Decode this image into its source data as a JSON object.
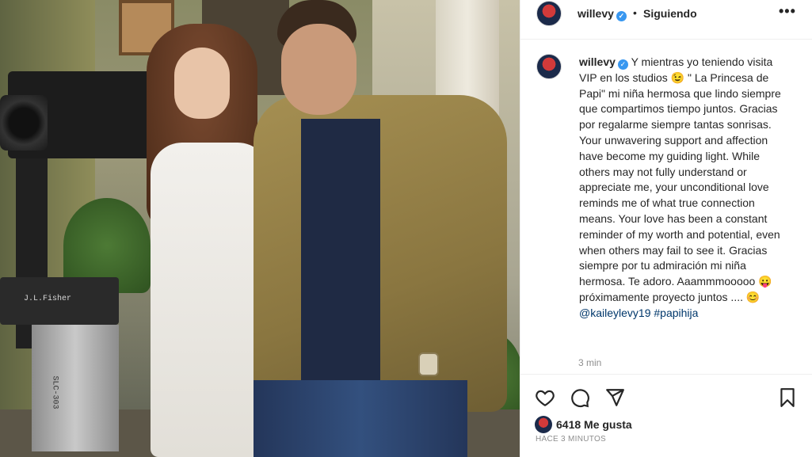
{
  "header": {
    "username": "willevy",
    "follow_status": "Siguiendo",
    "separator": "•"
  },
  "caption": {
    "username": "willevy",
    "text_intro": "Y mientras yo teniendo visita VIP en los studios",
    "emoji_1": "😉",
    "text_main": "\" La Princesa de Papi\" mi niña hermosa que lindo siempre que compartimos tiempo juntos. Gracias por regalarme siempre tantas sonrisas. Your unwavering support and affection have become my guiding light. While others may not fully understand or appreciate me, your unconditional love reminds me of what true connection means. Your love has been a constant reminder of my worth and potential, even when others may fail to see it. Gracias siempre por tu admiración mi niña hermosa. Te adoro. Aaammmooooo",
    "emoji_2": "😛",
    "text_end": "próximamente proyecto juntos ....",
    "emoji_3": "😊",
    "mention": "@kaileylevy19",
    "hashtag": "#papihija",
    "posted_short": "3 min"
  },
  "actions": {
    "like_icon": "heart-icon",
    "comment_icon": "comment-icon",
    "share_icon": "send-icon",
    "save_icon": "bookmark-icon"
  },
  "likes": {
    "text": "6418 Me gusta"
  },
  "time_ago": "HACE 3 MINUTOS",
  "photo": {
    "camera_label": "J.L.Fisher",
    "stand_label": "SLC-303"
  },
  "colors": {
    "verified": "#3897f0",
    "mention": "#00376b",
    "muted": "#8e8e8e"
  }
}
